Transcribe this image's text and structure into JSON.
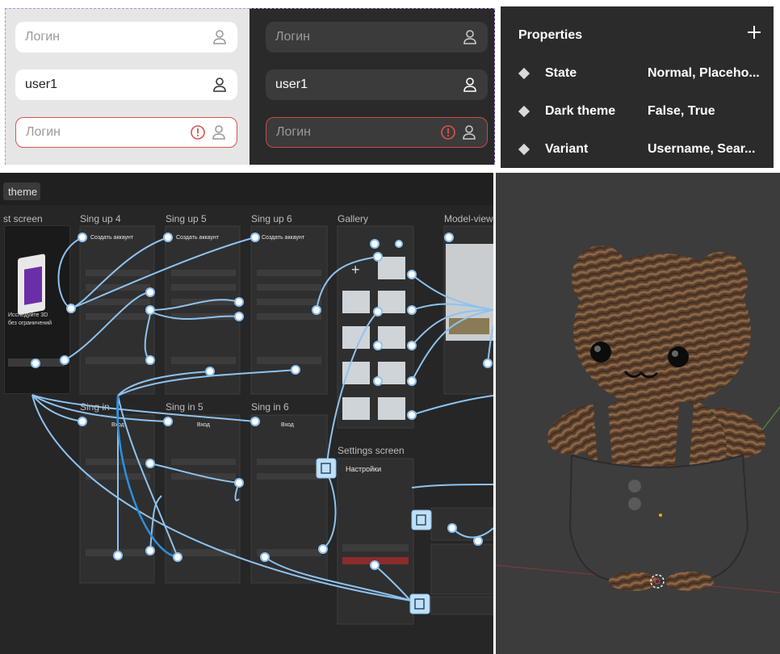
{
  "inputs_light": {
    "field1": {
      "placeholder": "Логин"
    },
    "field2": {
      "value": "user1"
    },
    "field3": {
      "placeholder": "Логин"
    }
  },
  "inputs_dark": {
    "field1": {
      "placeholder": "Логин"
    },
    "field2": {
      "value": "user1"
    },
    "field3": {
      "placeholder": "Логин"
    }
  },
  "properties": {
    "title": "Properties",
    "rows": [
      {
        "name": "State",
        "value": "Normal, Placeho..."
      },
      {
        "name": "Dark theme",
        "value": "False, True"
      },
      {
        "name": "Variant",
        "value": "Username, Sear..."
      }
    ]
  },
  "flow": {
    "tab": "theme",
    "screens": [
      {
        "label": "st screen"
      },
      {
        "label": "Sing up 4"
      },
      {
        "label": "Sing up 5"
      },
      {
        "label": "Sing up 6"
      },
      {
        "label": "Gallery"
      },
      {
        "label": "Model-view"
      },
      {
        "label": "Sing in"
      },
      {
        "label": "Sing in 5"
      },
      {
        "label": "Sing in 6"
      },
      {
        "label": "Settings screen"
      }
    ],
    "texts": {
      "create_account": "Создать аккаунт",
      "login": "Вход",
      "settings": "Настройки",
      "explore_1": "Исследуйте 3D",
      "explore_2": "без ограничений"
    }
  },
  "colors": {
    "error": "#d9534f",
    "flow_line": "#8ec3ef",
    "flow_bg": "#262626",
    "viewport_bg": "#3c3c3c"
  }
}
